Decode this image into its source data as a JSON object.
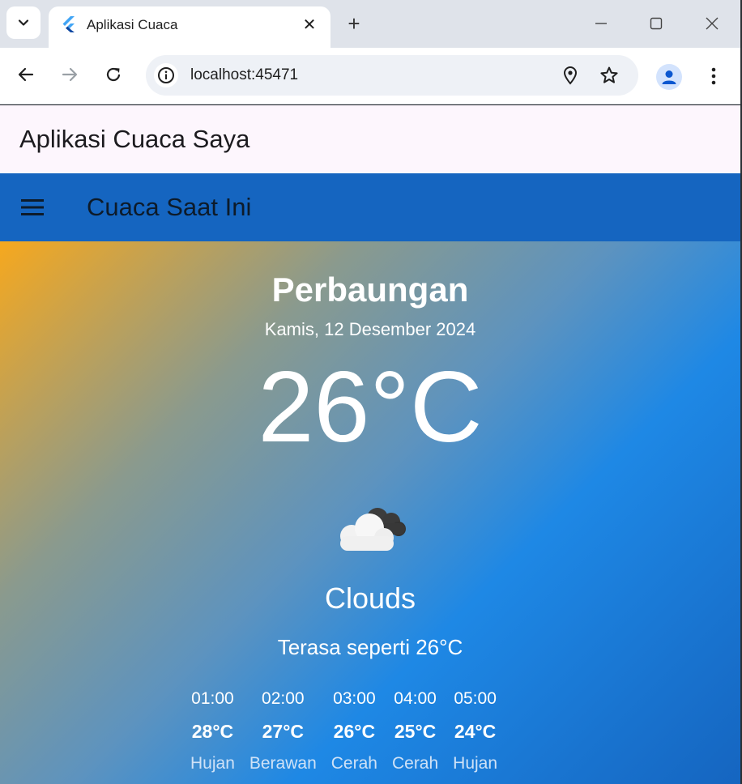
{
  "browser": {
    "tab_title": "Aplikasi Cuaca",
    "close_symbol": "✕",
    "new_tab_symbol": "+",
    "url": "localhost:45471"
  },
  "app": {
    "title": "Aplikasi Cuaca Saya",
    "screen_title": "Cuaca Saat Ini"
  },
  "weather": {
    "city": "Perbaungan",
    "date": "Kamis, 12 Desember 2024",
    "temperature": "26°C",
    "condition": "Clouds",
    "feels_like": "Terasa seperti 26°C",
    "icon": "clouds-icon",
    "hourly": [
      {
        "time": "01:00",
        "temp": "28°C",
        "desc": "Hujan"
      },
      {
        "time": "02:00",
        "temp": "27°C",
        "desc": "Berawan"
      },
      {
        "time": "03:00",
        "temp": "26°C",
        "desc": "Cerah"
      },
      {
        "time": "04:00",
        "temp": "25°C",
        "desc": "Cerah"
      },
      {
        "time": "05:00",
        "temp": "24°C",
        "desc": "Hujan"
      }
    ]
  },
  "colors": {
    "appbar_blue": "#1565c0",
    "appbar_top": "#fdf6fd",
    "gradient_start": "#f6a81e",
    "gradient_end": "#1565c0"
  }
}
